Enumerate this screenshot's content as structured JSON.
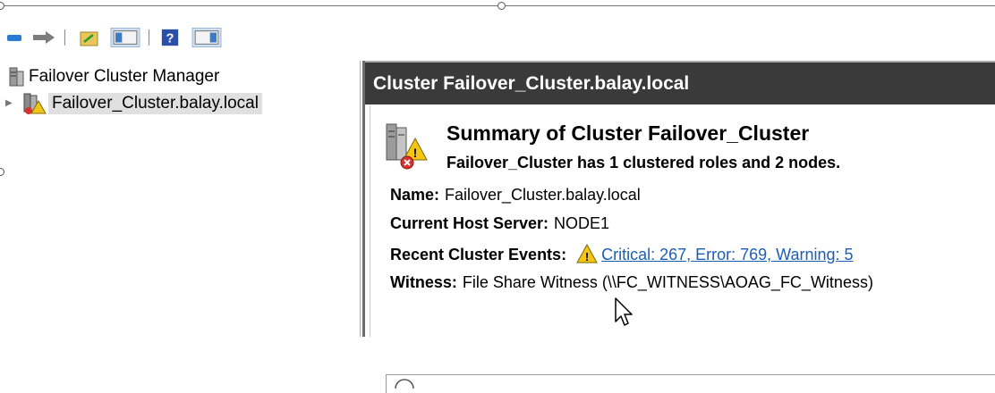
{
  "tree": {
    "root_label": "Failover Cluster Manager",
    "cluster_label": "Failover_Cluster.balay.local"
  },
  "pane": {
    "header": "Cluster Failover_Cluster.balay.local"
  },
  "summary": {
    "title": "Summary of Cluster Failover_Cluster",
    "subtitle": "Failover_Cluster has 1 clustered roles and 2 nodes."
  },
  "details": {
    "name_key": "Name:",
    "name_value": "Failover_Cluster.balay.local",
    "host_key": "Current Host Server:",
    "host_value": "NODE1",
    "events_key": "Recent Cluster Events:",
    "events_link": "Critical: 267, Error: 769, Warning: 5",
    "witness_key": "Witness:",
    "witness_value": "File Share Witness (\\\\FC_WITNESS\\AOAG_FC_Witness)"
  },
  "icons": {
    "toolbar": [
      "back-arrow-icon",
      "forward-arrow-icon",
      "up-folder-icon",
      "show-hide-console-tree-icon",
      "help-icon",
      "show-hide-action-pane-icon"
    ],
    "tree": [
      "failover-cluster-manager-icon",
      "cluster-icon"
    ],
    "status": [
      "cluster-warning-icon",
      "warning-icon"
    ]
  },
  "colors": {
    "header_bg": "#3a3a3a",
    "link": "#1a5fb4",
    "selection": "#e0e0e0"
  }
}
